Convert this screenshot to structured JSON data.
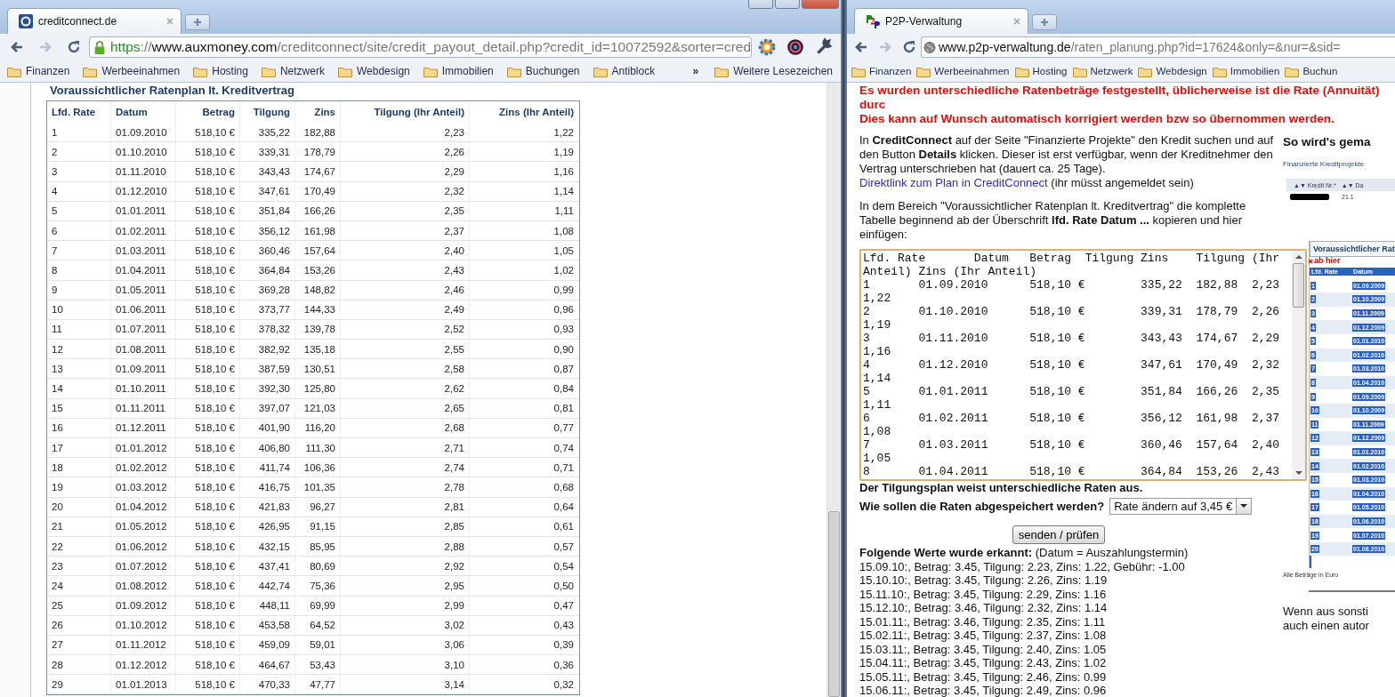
{
  "left_window": {
    "tab": {
      "title": "creditconnect.de"
    },
    "address": [
      {
        "text": "https",
        "kind": "secure"
      },
      {
        "text": "://",
        "kind": "path"
      },
      {
        "text": "www.auxmoney.com",
        "kind": "host"
      },
      {
        "text": "/creditconnect/site/credit_payout_detail.php?credit_id=10072592&sorter=cred",
        "kind": "path"
      }
    ],
    "bookmarks": [
      "Finanzen",
      "Werbeeinahmen",
      "Hosting",
      "Netzwerk",
      "Webdesign",
      "Immobilien",
      "Buchungen",
      "Antiblock"
    ],
    "more_bookmarks": "»",
    "other_bookmarks": "Weitere Lesezeichen",
    "page": {
      "heading": "Voraussichtlicher Ratenplan lt. Kreditvertrag",
      "table": {
        "columns": [
          "Lfd. Rate",
          "Datum",
          "Betrag",
          "Tilgung",
          "Zins",
          "Tilgung (Ihr Anteil)",
          "Zins (Ihr Anteil)"
        ],
        "rows": [
          [
            "1",
            "01.09.2010",
            "518,10 €",
            "335,22",
            "182,88",
            "2,23",
            "1,22"
          ],
          [
            "2",
            "01.10.2010",
            "518,10 €",
            "339,31",
            "178,79",
            "2,26",
            "1,19"
          ],
          [
            "3",
            "01.11.2010",
            "518,10 €",
            "343,43",
            "174,67",
            "2,29",
            "1,16"
          ],
          [
            "4",
            "01.12.2010",
            "518,10 €",
            "347,61",
            "170,49",
            "2,32",
            "1,14"
          ],
          [
            "5",
            "01.01.2011",
            "518,10 €",
            "351,84",
            "166,26",
            "2,35",
            "1,11"
          ],
          [
            "6",
            "01.02.2011",
            "518,10 €",
            "356,12",
            "161,98",
            "2,37",
            "1,08"
          ],
          [
            "7",
            "01.03.2011",
            "518,10 €",
            "360,46",
            "157,64",
            "2,40",
            "1,05"
          ],
          [
            "8",
            "01.04.2011",
            "518,10 €",
            "364,84",
            "153,26",
            "2,43",
            "1,02"
          ],
          [
            "9",
            "01.05.2011",
            "518,10 €",
            "369,28",
            "148,82",
            "2,46",
            "0,99"
          ],
          [
            "10",
            "01.06.2011",
            "518,10 €",
            "373,77",
            "144,33",
            "2,49",
            "0,96"
          ],
          [
            "11",
            "01.07.2011",
            "518,10 €",
            "378,32",
            "139,78",
            "2,52",
            "0,93"
          ],
          [
            "12",
            "01.08.2011",
            "518,10 €",
            "382,92",
            "135,18",
            "2,55",
            "0,90"
          ],
          [
            "13",
            "01.09.2011",
            "518,10 €",
            "387,59",
            "130,51",
            "2,58",
            "0,87"
          ],
          [
            "14",
            "01.10.2011",
            "518,10 €",
            "392,30",
            "125,80",
            "2,62",
            "0,84"
          ],
          [
            "15",
            "01.11.2011",
            "518,10 €",
            "397,07",
            "121,03",
            "2,65",
            "0,81"
          ],
          [
            "16",
            "01.12.2011",
            "518,10 €",
            "401,90",
            "116,20",
            "2,68",
            "0,77"
          ],
          [
            "17",
            "01.01.2012",
            "518,10 €",
            "406,80",
            "111,30",
            "2,71",
            "0,74"
          ],
          [
            "18",
            "01.02.2012",
            "518,10 €",
            "411,74",
            "106,36",
            "2,74",
            "0,71"
          ],
          [
            "19",
            "01.03.2012",
            "518,10 €",
            "416,75",
            "101,35",
            "2,78",
            "0,68"
          ],
          [
            "20",
            "01.04.2012",
            "518,10 €",
            "421,83",
            "96,27",
            "2,81",
            "0,64"
          ],
          [
            "21",
            "01.05.2012",
            "518,10 €",
            "426,95",
            "91,15",
            "2,85",
            "0,61"
          ],
          [
            "22",
            "01.06.2012",
            "518,10 €",
            "432,15",
            "85,95",
            "2,88",
            "0,57"
          ],
          [
            "23",
            "01.07.2012",
            "518,10 €",
            "437,41",
            "80,69",
            "2,92",
            "0,54"
          ],
          [
            "24",
            "01.08.2012",
            "518,10 €",
            "442,74",
            "75,36",
            "2,95",
            "0,50"
          ],
          [
            "25",
            "01.09.2012",
            "518,10 €",
            "448,11",
            "69,99",
            "2,99",
            "0,47"
          ],
          [
            "26",
            "01.10.2012",
            "518,10 €",
            "453,58",
            "64,52",
            "3,02",
            "0,43"
          ],
          [
            "27",
            "01.11.2012",
            "518,10 €",
            "459,09",
            "59,01",
            "3,06",
            "0,39"
          ],
          [
            "28",
            "01.12.2012",
            "518,10 €",
            "464,67",
            "53,43",
            "3,10",
            "0,36"
          ],
          [
            "29",
            "01.01.2013",
            "518,10 €",
            "470,33",
            "47,77",
            "3,14",
            "0,32"
          ]
        ]
      }
    }
  },
  "right_window": {
    "tab": {
      "title": "P2P-Verwaltung"
    },
    "address": [
      {
        "text": "www.p2p-verwaltung.de",
        "kind": "host"
      },
      {
        "text": "/raten_planung.php?id=17624&only=&nur=&sid=",
        "kind": "path"
      }
    ],
    "bookmarks": [
      "Finanzen",
      "Werbeeinahmen",
      "Hosting",
      "Netzwerk",
      "Webdesign",
      "Immobilien",
      "Buchun"
    ],
    "page": {
      "alerts": [
        "Es wurden unterschiedliche Ratenbeträge festgestellt, üblicherweise ist die Rate (Annuität) durc",
        "Dies kann auf Wunsch automatisch korrigiert werden bzw so übernommen werden."
      ],
      "instruction": "In **CreditConnect** auf der Seite \"Finanzierte Projekte\" den Kredit suchen und auf den Button **Details** klicken. Dieser ist erst verfügbar, wenn der Kreditnehmer den Vertrag unterschrieben hat (dauert ca. 25 Tage).",
      "link": "Direktlink zum Plan in CreditConnect",
      "link_note": "(ihr müsst angemeldet sein)",
      "copy_instruction": "In dem Bereich \"Voraussichtlicher Ratenplan lt. Kreditvertrag\" die komplette Tabelle beginnend ab der Überschrift **lfd. Rate Datum ...** kopieren und hier einfügen:",
      "paste_field": {
        "value": "Lfd. Rate\tDatum\tBetrag\tTilgung\tZins\tTilgung (Ihr\nAnteil) Zins (Ihr Anteil)\n1\t01.09.2010\t518,10 €\t335,22\t182,88\t2,23\n1,22\n2\t01.10.2010\t518,10 €\t339,31\t178,79\t2,26\n1,19\n3\t01.11.2010\t518,10 €\t343,43\t174,67\t2,29\n1,16\n4\t01.12.2010\t518,10 €\t347,61\t170,49\t2,32\n1,14\n5\t01.01.2011\t518,10 €\t351,84\t166,26\t2,35\n1,11\n6\t01.02.2011\t518,10 €\t356,12\t161,98\t2,37\n1,08\n7\t01.03.2011\t518,10 €\t360,46\t157,64\t2,40\n1,05\n8\t01.04.2011\t518,10 €\t364,84\t153,26\t2,43"
      },
      "warning": "Der Tilgungsplan weist unterschiedliche Raten aus.",
      "question": "Wie sollen die Raten abgespeichert werden?",
      "select_value": "Rate ändern auf 3,45 €",
      "submit": "senden / prüfen",
      "result_heading": "**Folgende Werte wurde erkannt:** (Datum = Auszahlungstermin)",
      "results": [
        "15.09.10:, Betrag: 3.45, Tilgung: 2.23, Zins: 1.22, Gebühr: -1.00",
        "15.10.10:, Betrag: 3.45, Tilgung: 2.26, Zins: 1.19",
        "15.11.10:, Betrag: 3.45, Tilgung: 2.29, Zins: 1.16",
        "15.12.10:, Betrag: 3.46, Tilgung: 2.32, Zins: 1.14",
        "15.01.11:, Betrag: 3.46, Tilgung: 2.35, Zins: 1.11",
        "15.02.11:, Betrag: 3.45, Tilgung: 2.37, Zins: 1.08",
        "15.03.11:, Betrag: 3.45, Tilgung: 2.40, Zins: 1.05",
        "15.04.11:, Betrag: 3.45, Tilgung: 2.43, Zins: 1.02",
        "15.05.11:, Betrag: 3.45, Tilgung: 2.46, Zins: 0.99",
        "15.06.11:, Betrag: 3.45, Tilgung: 2.49, Zins: 0.96"
      ],
      "side": {
        "heading": "So wird's gema",
        "example": {
          "caption": "Finanzierte Kreditprojekte",
          "columns": [
            "▲▼ Kredit Nr.*",
            "▲▼ Da"
          ],
          "cell": "21.1",
          "plan_title": "Voraussichtlicher Rat",
          "marker": "ab hier",
          "plan_columns": [
            "Lfd. Rate",
            "Datum"
          ],
          "plan_rows": [
            [
              "1",
              "01.09.2009"
            ],
            [
              "2",
              "01.10.2009"
            ],
            [
              "3",
              "01.11.2009"
            ],
            [
              "4",
              "01.12.2009"
            ],
            [
              "5",
              "01.01.2010"
            ],
            [
              "6",
              "01.02.2010"
            ],
            [
              "7",
              "01.03.2010"
            ],
            [
              "8",
              "01.04.2010"
            ],
            [
              "9",
              "01.09.2009"
            ],
            [
              "10",
              "01.10.2009"
            ],
            [
              "11",
              "01.11.2009"
            ],
            [
              "12",
              "01.12.2009"
            ],
            [
              "13",
              "01.01.2010"
            ],
            [
              "14",
              "01.02.2010"
            ],
            [
              "15",
              "01.03.2010"
            ],
            [
              "16",
              "01.04.2010"
            ],
            [
              "17",
              "01.05.2010"
            ],
            [
              "18",
              "01.06.2010"
            ],
            [
              "19",
              "01.07.2010"
            ],
            [
              "20",
              "01.08.2010"
            ]
          ],
          "footnote": "Alle Beträge in Euro"
        },
        "note_lines": [
          "Wenn aus sonsti",
          "auch einen autor"
        ]
      }
    }
  }
}
